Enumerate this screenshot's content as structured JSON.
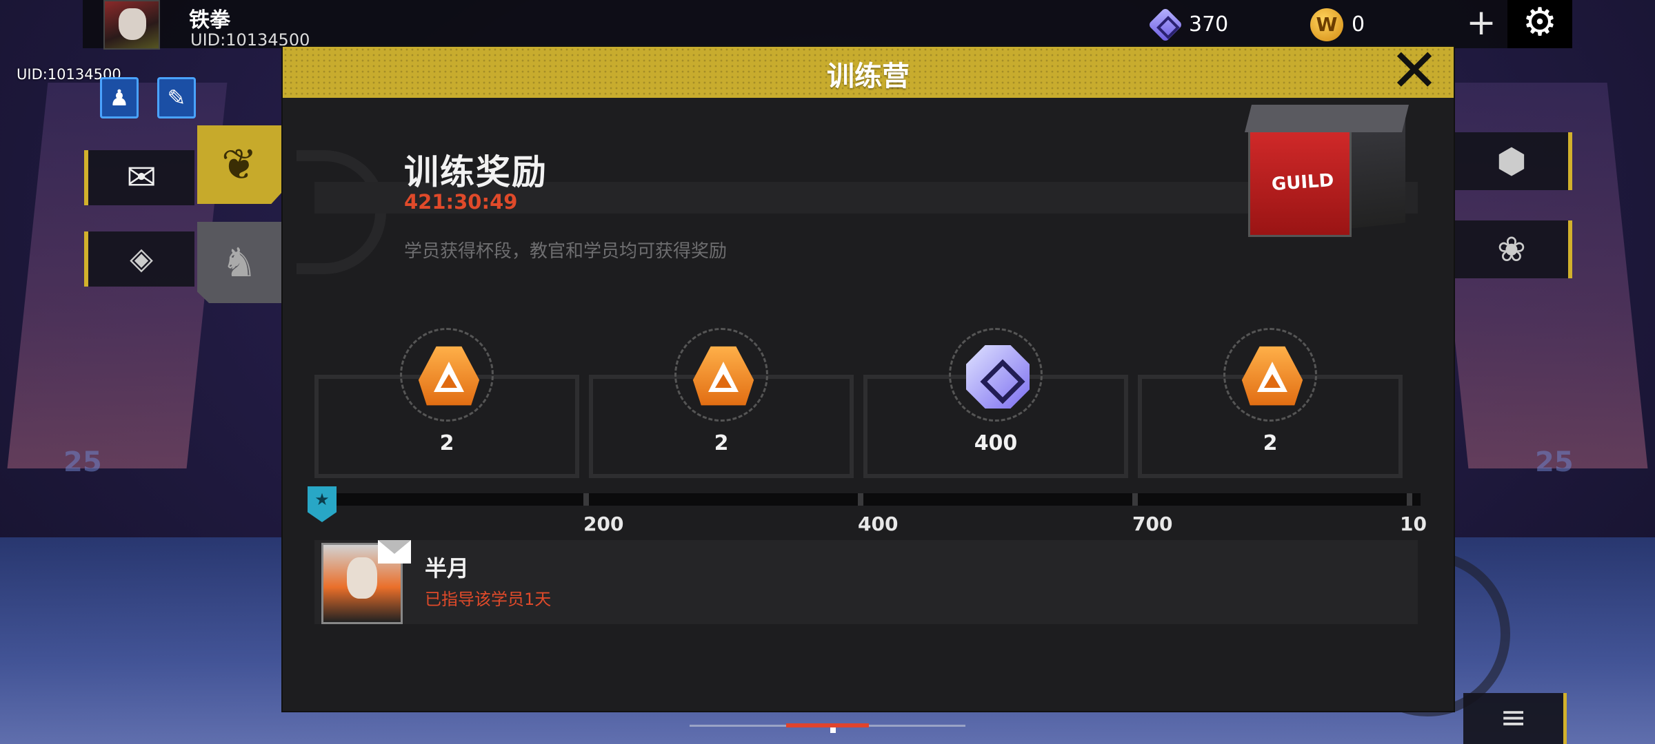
{
  "player": {
    "name": "铁拳",
    "uid": "UID:10134500",
    "uid_corner": "UID:10134500"
  },
  "currency": {
    "gems": "370",
    "coins": "0",
    "coin_glyph": "W"
  },
  "topbar_icons": {
    "plus": "+",
    "settings": "⚙"
  },
  "side_icons": {
    "qq": "♟",
    "notes": "✎",
    "mail": "✉",
    "tree": "❦",
    "id": "◈",
    "mentor": "♞",
    "shield": "⬢",
    "lotus": "❀",
    "menu": "≡"
  },
  "modal": {
    "title": "训练营",
    "close": "✕",
    "reward_title": "训练奖励",
    "timer": "421:30:49",
    "description": "学员获得杯段，教官和学员均可获得奖励",
    "crate_label": "GUILD"
  },
  "rewards": [
    {
      "icon": "trophy-pyramid-icon",
      "count": "2"
    },
    {
      "icon": "trophy-pyramid-icon",
      "count": "2"
    },
    {
      "icon": "gem-icon",
      "count": "400"
    },
    {
      "icon": "trophy-pyramid-icon",
      "count": "2"
    }
  ],
  "progress": {
    "ticks": [
      "200",
      "400",
      "700",
      "10"
    ],
    "marker_glyph": "★"
  },
  "student": {
    "name": "半月",
    "status": "已指导该学员1天"
  },
  "colors": {
    "header_gold": "#c8ac2e",
    "accent_red": "#e04a2a",
    "marker_cyan": "#28a7c6"
  }
}
